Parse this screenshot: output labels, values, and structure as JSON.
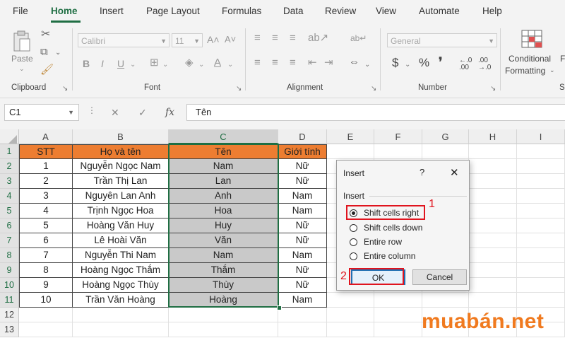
{
  "ribbon_tabs": [
    "File",
    "Home",
    "Insert",
    "Page Layout",
    "Formulas",
    "Data",
    "Review",
    "View",
    "Automate",
    "Help"
  ],
  "ribbon": {
    "clipboard": {
      "label": "Clipboard",
      "paste": "Paste"
    },
    "font": {
      "label": "Font",
      "font_name": "Calibri",
      "font_size": "11"
    },
    "alignment": {
      "label": "Alignment"
    },
    "number": {
      "label": "Number",
      "format": "General"
    },
    "styles": {
      "conditional_formatting": "Conditional",
      "conditional_formatting2": "Formatting",
      "format_as_table_partial": "F",
      "styles_partial": "S"
    }
  },
  "formula_bar": {
    "name_box": "C1",
    "fx": "fx",
    "content": "Tên"
  },
  "grid": {
    "columns": [
      "A",
      "B",
      "C",
      "D",
      "E",
      "F",
      "G",
      "H",
      "I"
    ],
    "rows": [
      "1",
      "2",
      "3",
      "4",
      "5",
      "6",
      "7",
      "8",
      "9",
      "10",
      "11",
      "12",
      "13"
    ],
    "header": [
      "STT",
      "Họ và tên",
      "Tên",
      "Giới tính"
    ],
    "data": [
      [
        "1",
        "Nguyễn Ngọc Nam",
        "Nam",
        "Nữ"
      ],
      [
        "2",
        "Trần Thị Lan",
        "Lan",
        "Nữ"
      ],
      [
        "3",
        "Nguyên Lan Anh",
        "Anh",
        "Nam"
      ],
      [
        "4",
        "Trịnh Ngọc Hoa",
        "Hoa",
        "Nam"
      ],
      [
        "5",
        "Hoàng Văn Huy",
        "Huy",
        "Nữ"
      ],
      [
        "6",
        "Lê Hoài Văn",
        "Văn",
        "Nữ"
      ],
      [
        "7",
        "Nguyễn Thi Nam",
        "Nam",
        "Nam"
      ],
      [
        "8",
        "Hoàng Ngọc Thắm",
        "Thắm",
        "Nữ"
      ],
      [
        "9",
        "Hoàng Ngọc Thùy",
        "Thùy",
        "Nữ"
      ],
      [
        "10",
        "Trần Văn Hoàng",
        "Hoàng",
        "Nam"
      ]
    ],
    "header_color": "#ed7d31",
    "selection_color": "#c9c9c9"
  },
  "dialog": {
    "title": "Insert",
    "help": "?",
    "close": "✕",
    "group_label": "Insert",
    "options": [
      "Shift cells right",
      "Shift cells down",
      "Entire row",
      "Entire column"
    ],
    "selected_index": 0,
    "ok": "OK",
    "cancel": "Cancel"
  },
  "annotations": {
    "step1": "1",
    "step2": "2",
    "color": "#e0141e"
  },
  "watermark": "muabán.net"
}
